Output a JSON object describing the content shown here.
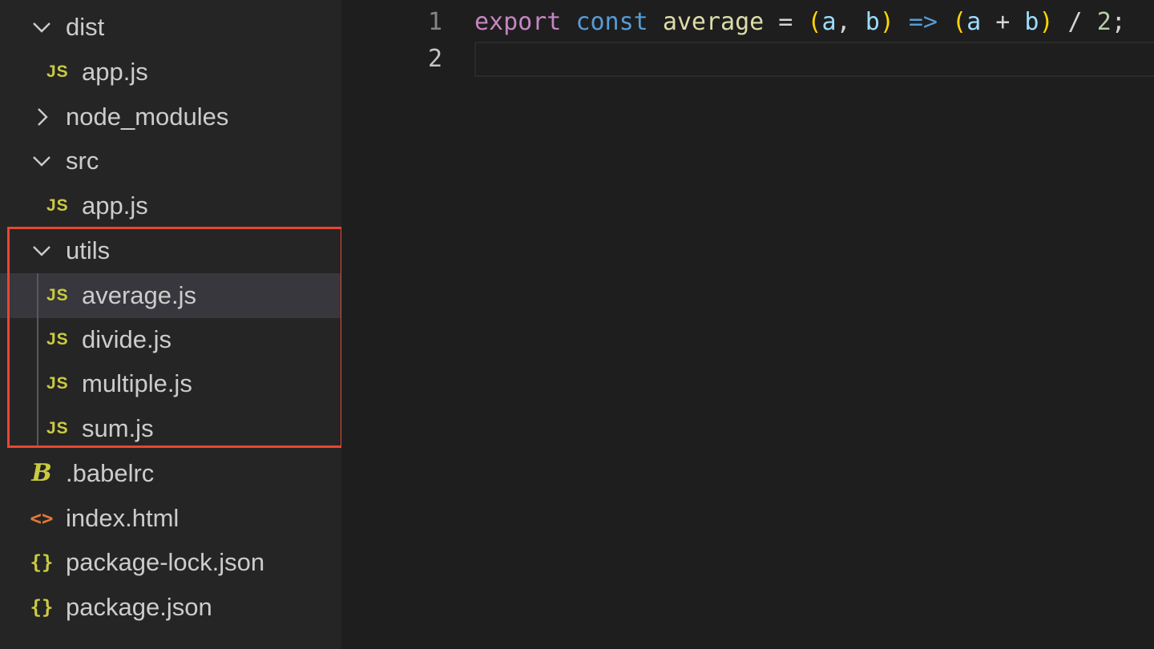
{
  "explorer": {
    "folders": {
      "dist": "dist",
      "node_modules": "node_modules",
      "src": "src",
      "utils": "utils"
    },
    "dist_files": [
      "app.js"
    ],
    "src_files": [
      "app.js"
    ],
    "utils_files": [
      "average.js",
      "divide.js",
      "multiple.js",
      "sum.js"
    ],
    "root_files": [
      ".babelrc",
      "index.html",
      "package-lock.json",
      "package.json"
    ],
    "selected_file": "average.js",
    "icons": {
      "js": "JS",
      "babel": "B",
      "html": "<>",
      "json": "{}"
    },
    "highlight_color": "#e8472f"
  },
  "editor": {
    "line_numbers": [
      "1",
      "2"
    ],
    "code": {
      "export": "export",
      "const": "const",
      "name": "average",
      "eq": " = ",
      "paren_open": "(",
      "param_a": "a",
      "comma": ", ",
      "param_b": "b",
      "paren_close": ")",
      "arrow": " => ",
      "paren_open2": "(",
      "param_a2": "a",
      "plus": " + ",
      "param_b2": "b",
      "paren_close2": ")",
      "div": " / ",
      "num": "2",
      "semi": ";"
    }
  }
}
